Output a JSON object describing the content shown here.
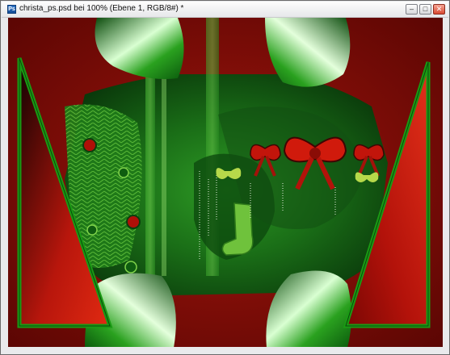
{
  "window": {
    "title": "christa_ps.psd bei 100% (Ebene 1, RGB/8#) *",
    "app_icon": "photoshop-document-icon",
    "buttons": {
      "minimize": "‒",
      "maximize": "□",
      "close": "✕"
    }
  },
  "colors": {
    "dark_red": "#7a0a05",
    "bright_red": "#d2140a",
    "green": "#1f8a1a",
    "dark_green": "#0b3f0c",
    "light_green": "#7fd24a"
  }
}
